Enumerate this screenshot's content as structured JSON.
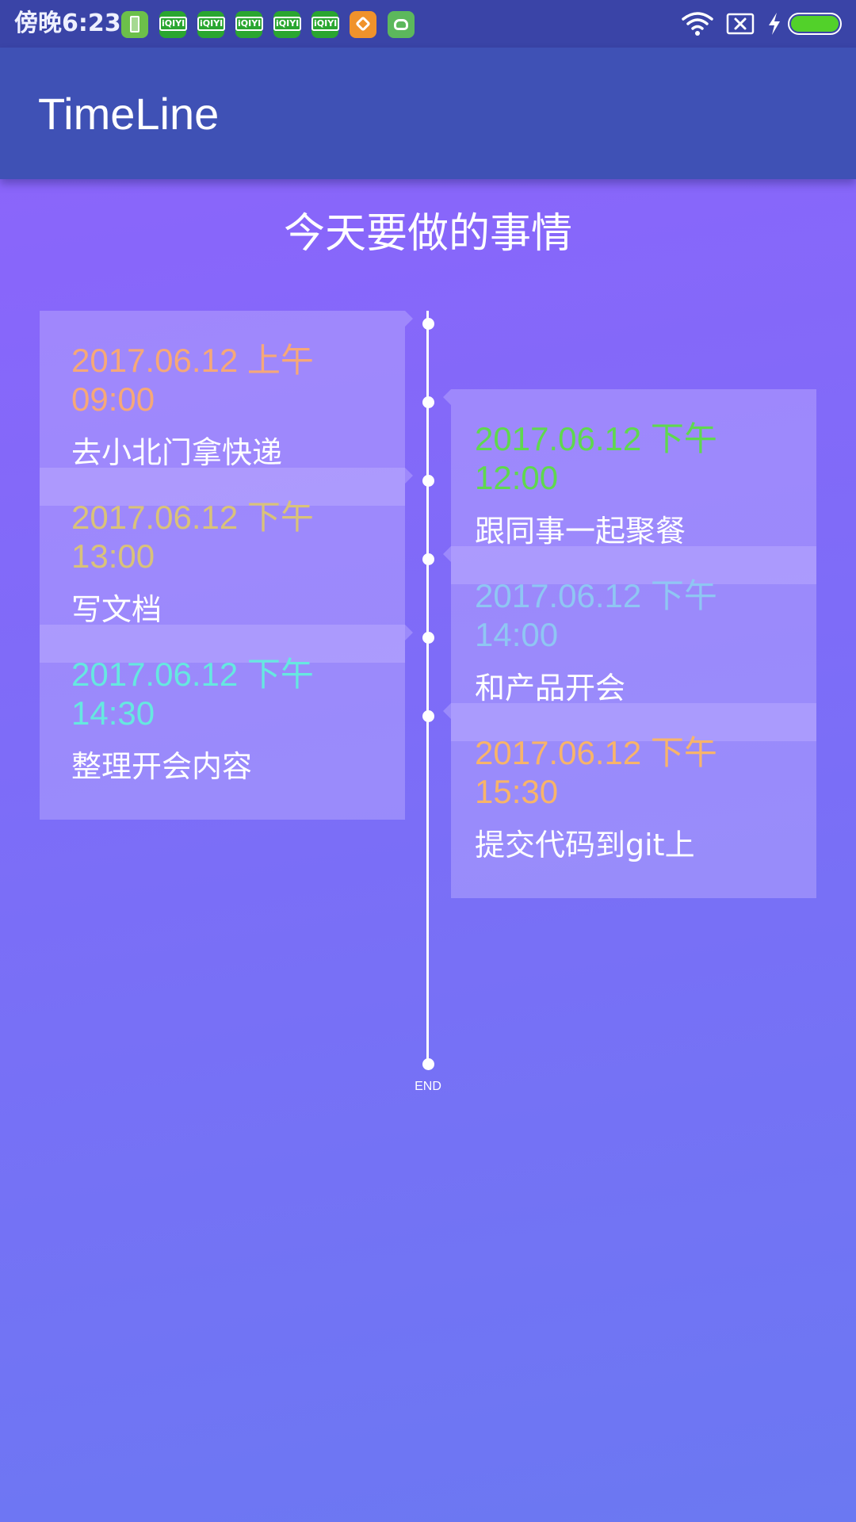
{
  "status_bar": {
    "time": "傍晚6:23",
    "notification_icons": [
      "battery-app-icon",
      "iqiyi-icon",
      "iqiyi-icon",
      "iqiyi-icon",
      "iqiyi-icon",
      "iqiyi-icon",
      "orange-app-icon",
      "green-bot-app-icon"
    ],
    "iqiyi_label": "iQIYI",
    "system_icons": [
      "wifi-icon",
      "no-sim-icon",
      "charging-icon",
      "battery-icon"
    ],
    "battery_level": 1.0,
    "battery_color": "#52d12a"
  },
  "app_bar": {
    "title": "TimeLine",
    "color": "#3f51b5"
  },
  "page": {
    "heading": "今天要做的事情"
  },
  "timeline": {
    "end_label": "END",
    "events": [
      {
        "side": "left",
        "time": "2017.06.12 上午09:00",
        "text": "去小北门拿快递",
        "color": "#f6a878"
      },
      {
        "side": "right",
        "time": "2017.06.12 下午12:00",
        "text": "跟同事一起聚餐",
        "color": "#5fd84e"
      },
      {
        "side": "left",
        "time": "2017.06.12 下午13:00",
        "text": "写文档",
        "color": "#d9c27a"
      },
      {
        "side": "right",
        "time": "2017.06.12 下午14:00",
        "text": "和产品开会",
        "color": "#8fc6f3"
      },
      {
        "side": "left",
        "time": "2017.06.12 下午14:30",
        "text": "整理开会内容",
        "color": "#66e8e0"
      },
      {
        "side": "right",
        "time": "2017.06.12 下午15:30",
        "text": "提交代码到git上",
        "color": "#f8b46a"
      }
    ]
  }
}
